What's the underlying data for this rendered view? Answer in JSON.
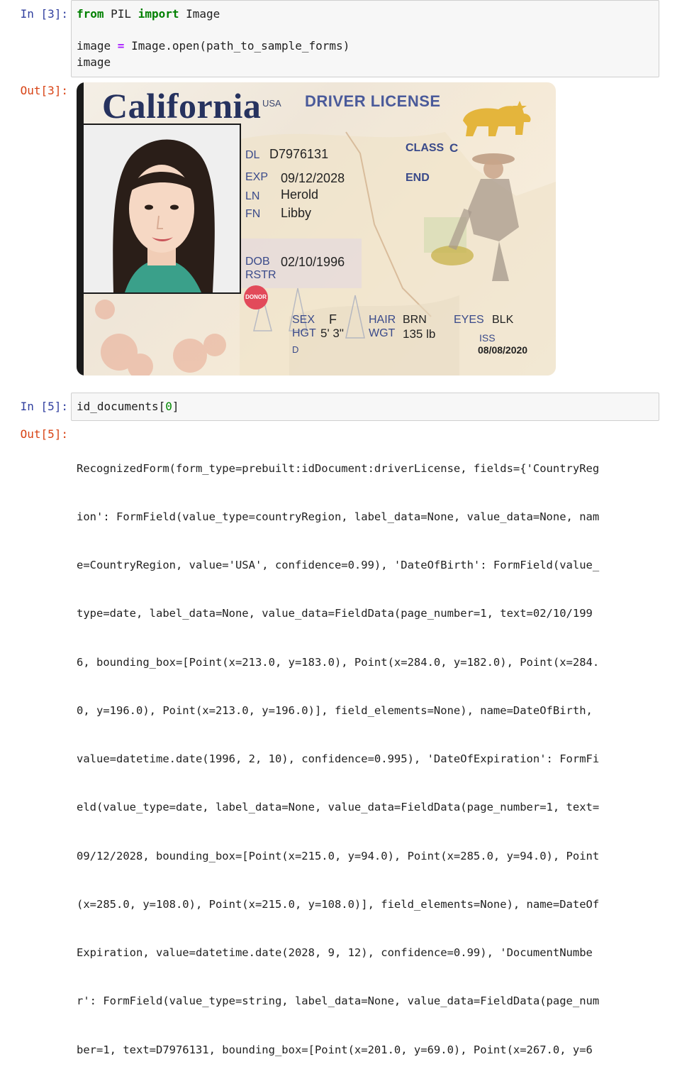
{
  "cells": {
    "in3": {
      "prompt": "In [3]:",
      "line1_kw1": "from",
      "line1_mod": " PIL ",
      "line1_kw2": "import",
      "line1_name": " Image",
      "line2_a": "image ",
      "line2_op": "=",
      "line2_b": " Image.open(path_to_sample_forms)",
      "line3": "image"
    },
    "out3": {
      "prompt": "Out[3]:"
    },
    "in5": {
      "prompt": "In [5]:",
      "code_a": "id_documents[",
      "code_num": "0",
      "code_b": "]"
    },
    "out5": {
      "prompt": "Out[5]:",
      "lines": [
        "RecognizedForm(form_type=prebuilt:idDocument:driverLicense, fields={'CountryReg",
        "ion': FormField(value_type=countryRegion, label_data=None, value_data=None, nam",
        "e=CountryRegion, value='USA', confidence=0.99), 'DateOfBirth': FormField(value_",
        "type=date, label_data=None, value_data=FieldData(page_number=1, text=02/10/199",
        "6, bounding_box=[Point(x=213.0, y=183.0), Point(x=284.0, y=182.0), Point(x=284.",
        "0, y=196.0), Point(x=213.0, y=196.0)], field_elements=None), name=DateOfBirth,",
        "value=datetime.date(1996, 2, 10), confidence=0.995), 'DateOfExpiration': FormFi",
        "eld(value_type=date, label_data=None, value_data=FieldData(page_number=1, text=",
        "09/12/2028, bounding_box=[Point(x=215.0, y=94.0), Point(x=285.0, y=94.0), Point",
        "(x=285.0, y=108.0), Point(x=215.0, y=108.0)], field_elements=None), name=DateOf",
        "Expiration, value=datetime.date(2028, 9, 12), confidence=0.99), 'DocumentNumbe",
        "r': FormField(value_type=string, label_data=None, value_data=FieldData(page_num",
        "ber=1, text=D7976131, bounding_box=[Point(x=201.0, y=69.0), Point(x=267.0, y=6"
      ]
    }
  },
  "license": {
    "state": "California",
    "usa": "USA",
    "doc_title": "DRIVER LICENSE",
    "dl_label": "DL",
    "dl_value": "D7976131",
    "class_label": "CLASS",
    "class_value": "C",
    "exp_label": "EXP",
    "exp_value": "09/12/2028",
    "end_label": "END",
    "ln_label": "LN",
    "ln_value": "Herold",
    "fn_label": "FN",
    "fn_value": "Libby",
    "dob_label": "DOB",
    "dob_value": "02/10/1996",
    "rstr_label": "RSTR",
    "donor": "DONOR",
    "sex_label": "SEX",
    "sex_value": "F",
    "hgt_label": "HGT",
    "hgt_value": "5' 3\"",
    "hair_label": "HAIR",
    "hair_value": "BRN",
    "wgt_label": "WGT",
    "wgt_value": "135 lb",
    "eyes_label": "EYES",
    "eyes_value": "BLK",
    "iss_label": "ISS",
    "iss_value": "08/08/2020",
    "d_label": "D"
  },
  "colors": {
    "in_prompt": "#303f9f",
    "out_prompt": "#d84315",
    "keyword": "#008000",
    "operator": "#aa22ff",
    "card_title": "#26325e",
    "card_label": "#3a4a8a"
  }
}
